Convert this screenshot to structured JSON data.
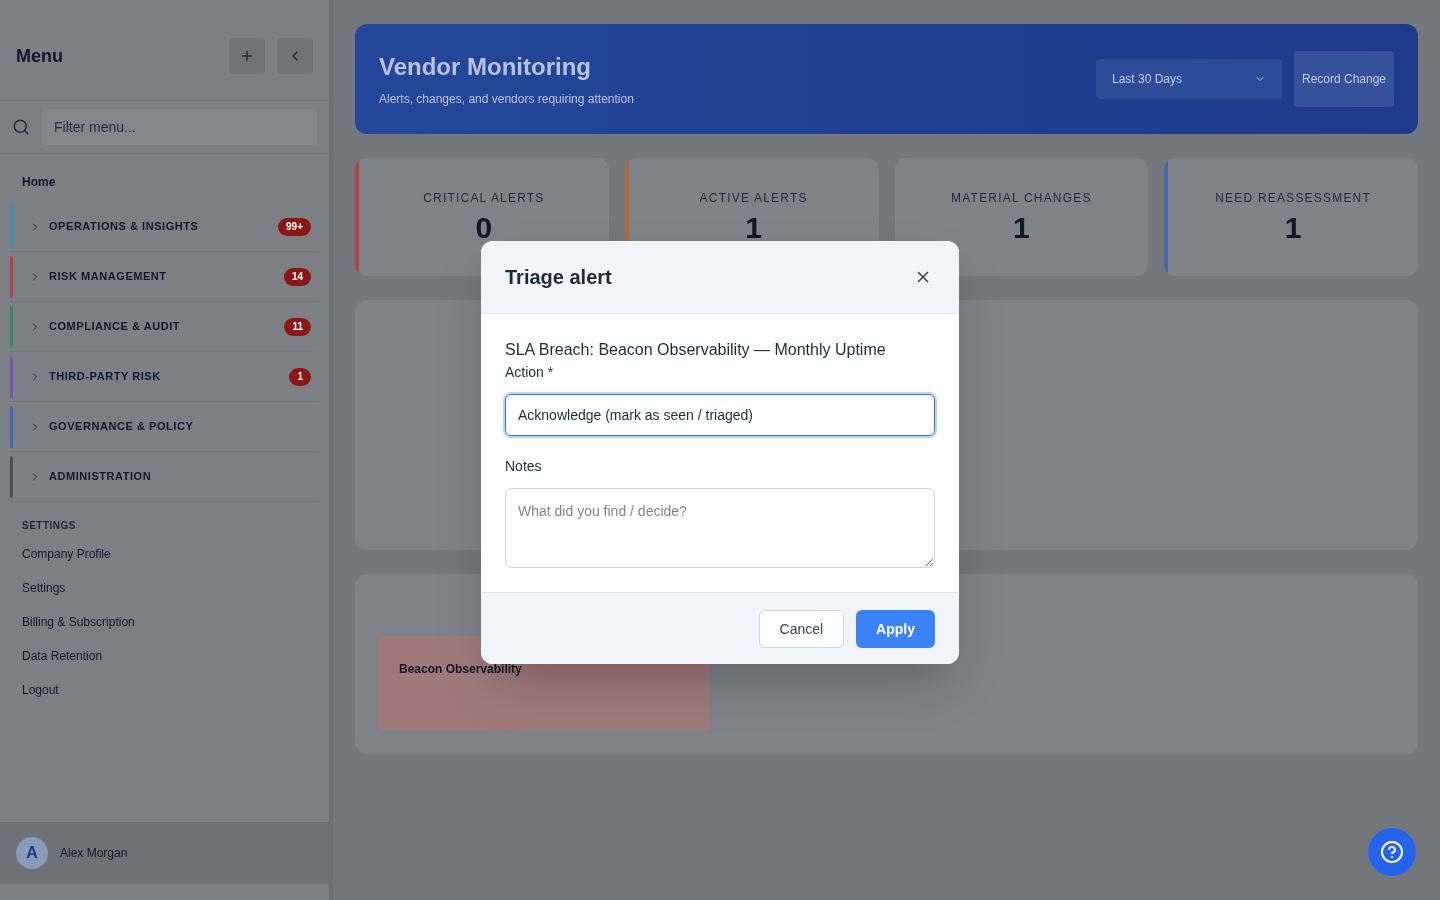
{
  "sidebar": {
    "title": "Menu",
    "filter_placeholder": "Filter menu...",
    "home": "Home",
    "groups": [
      {
        "label": "OPERATIONS & INSIGHTS",
        "color": "#3d8fb3",
        "badge": "99+"
      },
      {
        "label": "RISK MANAGEMENT",
        "color": "#b04444",
        "badge": "14"
      },
      {
        "label": "COMPLIANCE & AUDIT",
        "color": "#2f8a6a",
        "badge": "11"
      },
      {
        "label": "THIRD-PARTY RISK",
        "color": "#6f55b8",
        "badge": "1"
      },
      {
        "label": "GOVERNANCE & POLICY",
        "color": "#4366b0"
      },
      {
        "label": "ADMINISTRATION",
        "color": "#4b5058"
      }
    ],
    "settings_heading": "SETTINGS",
    "settings": [
      "Company Profile",
      "Settings",
      "Billing & Subscription",
      "Data Retention",
      "Logout"
    ],
    "user": {
      "initial": "A",
      "name": "Alex Morgan"
    }
  },
  "header": {
    "title": "Vendor Monitoring",
    "subtitle": "Alerts, changes, and vendors requiring attention",
    "range": "Last 30 Days",
    "button": "Record Change"
  },
  "stats": [
    {
      "label": "CRITICAL ALERTS",
      "value": "0",
      "color": "#b04444"
    },
    {
      "label": "ACTIVE ALERTS",
      "value": "1",
      "color": "#b5672f"
    },
    {
      "label": "MATERIAL CHANGES",
      "value": "1"
    },
    {
      "label": "NEED REASSESSMENT",
      "value": "1",
      "color": "#4366b0"
    }
  ],
  "vendors_card": {
    "name": "Beacon Observability"
  },
  "modal": {
    "title": "Triage alert",
    "subject": "SLA Breach: Beacon Observability — Monthly Uptime",
    "action_label": "Action *",
    "action_value": "Acknowledge (mark as seen / triaged)",
    "notes_label": "Notes",
    "notes_placeholder": "What did you find / decide?",
    "cancel": "Cancel",
    "apply": "Apply"
  }
}
